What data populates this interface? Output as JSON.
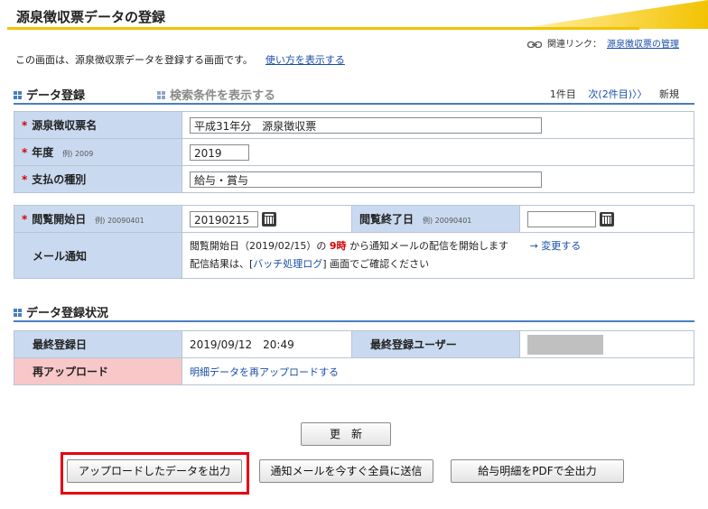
{
  "page": {
    "title": "源泉徴収票データの登録",
    "related_prefix": "関連リンク：",
    "related_link": "源泉徴収票の管理",
    "description": "この画面は、源泉徴収票データを登録する画面です。",
    "howto_link": "使い方を表示する"
  },
  "section_data": {
    "title": "データ登録",
    "search_toggle": "検索条件を表示する",
    "pager_count": "1件目",
    "pager_next": "次(2件目)〉〉",
    "pager_new": "新規"
  },
  "form1": {
    "name_label": "源泉徴収票名",
    "name_value": "平成31年分　源泉徴収票",
    "year_label": "年度",
    "year_example": "例) 2009",
    "year_value": "2019",
    "payment_label": "支払の種別",
    "payment_value": "給与・賞与"
  },
  "form2": {
    "start_label": "閲覧開始日",
    "start_example": "例) 20090401",
    "start_value": "20190215",
    "end_label": "閲覧終了日",
    "end_example": "例) 20090401",
    "end_value": "",
    "mail_label": "メール通知",
    "mail_line1_a": "閲覧開始日（2019/02/15）の",
    "mail_line1_time": "9時",
    "mail_line1_b": "から通知メールの配信を開始します",
    "mail_change_link": "→ 変更する",
    "mail_line2_a": "配信結果は、[",
    "mail_line2_link": "バッチ処理ログ",
    "mail_line2_b": "] 画面でご確認ください"
  },
  "section_status": {
    "title": "データ登録状況",
    "last_date_label": "最終登録日",
    "last_date_value": "2019/09/12　20:49",
    "last_user_label": "最終登録ユーザー",
    "reupload_label": "再アップロード",
    "reupload_link": "明細データを再アップロードする"
  },
  "buttons": {
    "update": "更　新",
    "export_uploaded": "アップロードしたデータを出力",
    "send_mail": "通知メールを今すぐ全員に送信",
    "pdf_export": "給与明細をPDFで全出力"
  },
  "colors": {
    "accent_yellow": "#f2c200",
    "label_blue": "#c9daf0",
    "label_pink": "#f8c8c8",
    "highlight_red": "#e60012",
    "link_blue": "#1a4ea8"
  }
}
